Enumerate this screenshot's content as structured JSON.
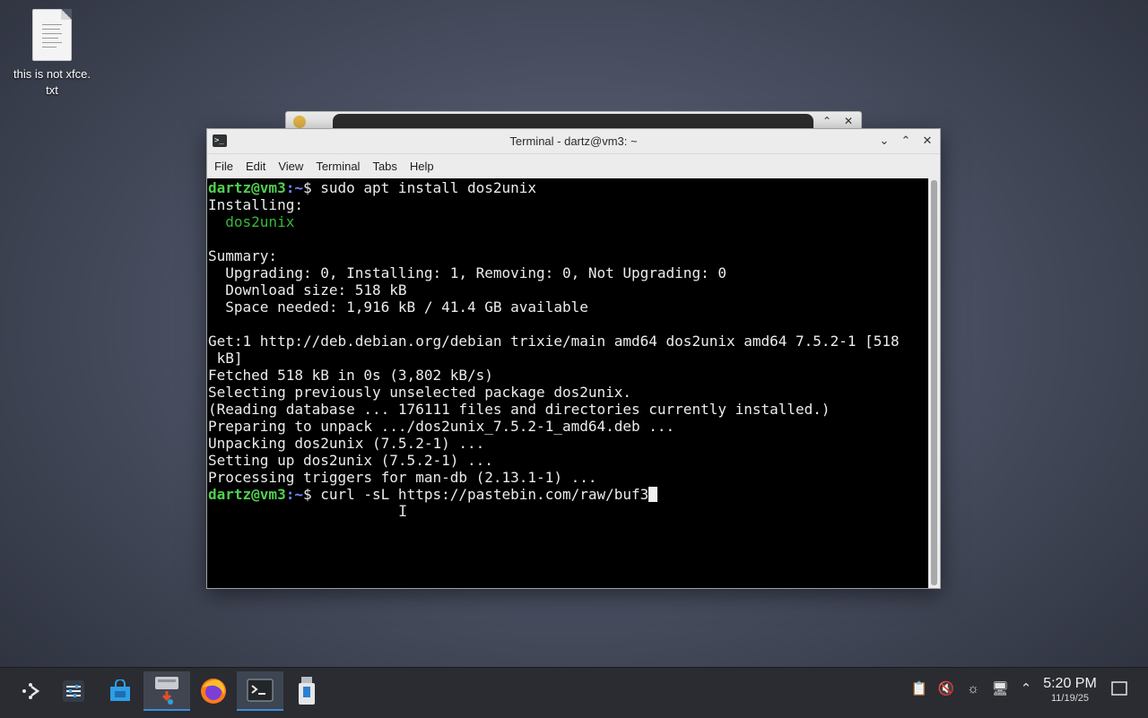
{
  "desktop": {
    "icons": [
      {
        "label": "this is not xfce.\ntxt",
        "icon": "text-file-icon"
      }
    ]
  },
  "terminal_window": {
    "title": "Terminal - dartz@vm3: ~",
    "menu": [
      "File",
      "Edit",
      "View",
      "Terminal",
      "Tabs",
      "Help"
    ],
    "prompt_user": "dartz@vm3",
    "prompt_path": ":~",
    "prompt_symbol": "$ ",
    "lines": [
      {
        "kind": "prompt",
        "text": "sudo apt install dos2unix"
      },
      {
        "kind": "plain",
        "text": "Installing:"
      },
      {
        "kind": "package",
        "text": "  dos2unix"
      },
      {
        "kind": "plain",
        "text": ""
      },
      {
        "kind": "plain",
        "text": "Summary:"
      },
      {
        "kind": "plain",
        "text": "  Upgrading: 0, Installing: 1, Removing: 0, Not Upgrading: 0"
      },
      {
        "kind": "plain",
        "text": "  Download size: 518 kB"
      },
      {
        "kind": "plain",
        "text": "  Space needed: 1,916 kB / 41.4 GB available"
      },
      {
        "kind": "plain",
        "text": ""
      },
      {
        "kind": "plain",
        "text": "Get:1 http://deb.debian.org/debian trixie/main amd64 dos2unix amd64 7.5.2-1 [518"
      },
      {
        "kind": "plain",
        "text": " kB]"
      },
      {
        "kind": "plain",
        "text": "Fetched 518 kB in 0s (3,802 kB/s)"
      },
      {
        "kind": "plain",
        "text": "Selecting previously unselected package dos2unix."
      },
      {
        "kind": "plain",
        "text": "(Reading database ... 176111 files and directories currently installed.)"
      },
      {
        "kind": "plain",
        "text": "Preparing to unpack .../dos2unix_7.5.2-1_amd64.deb ..."
      },
      {
        "kind": "plain",
        "text": "Unpacking dos2unix (7.5.2-1) ..."
      },
      {
        "kind": "plain",
        "text": "Setting up dos2unix (7.5.2-1) ..."
      },
      {
        "kind": "plain",
        "text": "Processing triggers for man-db (2.13.1-1) ..."
      },
      {
        "kind": "prompt_active",
        "text": "curl -sL https://pastebin.com/raw/buf3"
      }
    ]
  },
  "taskbar": {
    "items": [
      {
        "name": "application-launcher",
        "icon": "kde-launcher-icon"
      },
      {
        "name": "system-settings",
        "icon": "settings-sliders-icon"
      },
      {
        "name": "discover-store",
        "icon": "store-bag-icon"
      },
      {
        "name": "install-package",
        "icon": "package-install-icon"
      },
      {
        "name": "firefox",
        "icon": "firefox-icon"
      },
      {
        "name": "terminal",
        "icon": "terminal-icon"
      },
      {
        "name": "usb-drive",
        "icon": "usb-drive-icon"
      }
    ],
    "tray_icons": [
      "clipboard-icon",
      "volume-muted-icon",
      "brightness-icon",
      "network-icon",
      "expand-tray-icon"
    ],
    "time": "5:20 PM",
    "date": "11/19/25"
  }
}
